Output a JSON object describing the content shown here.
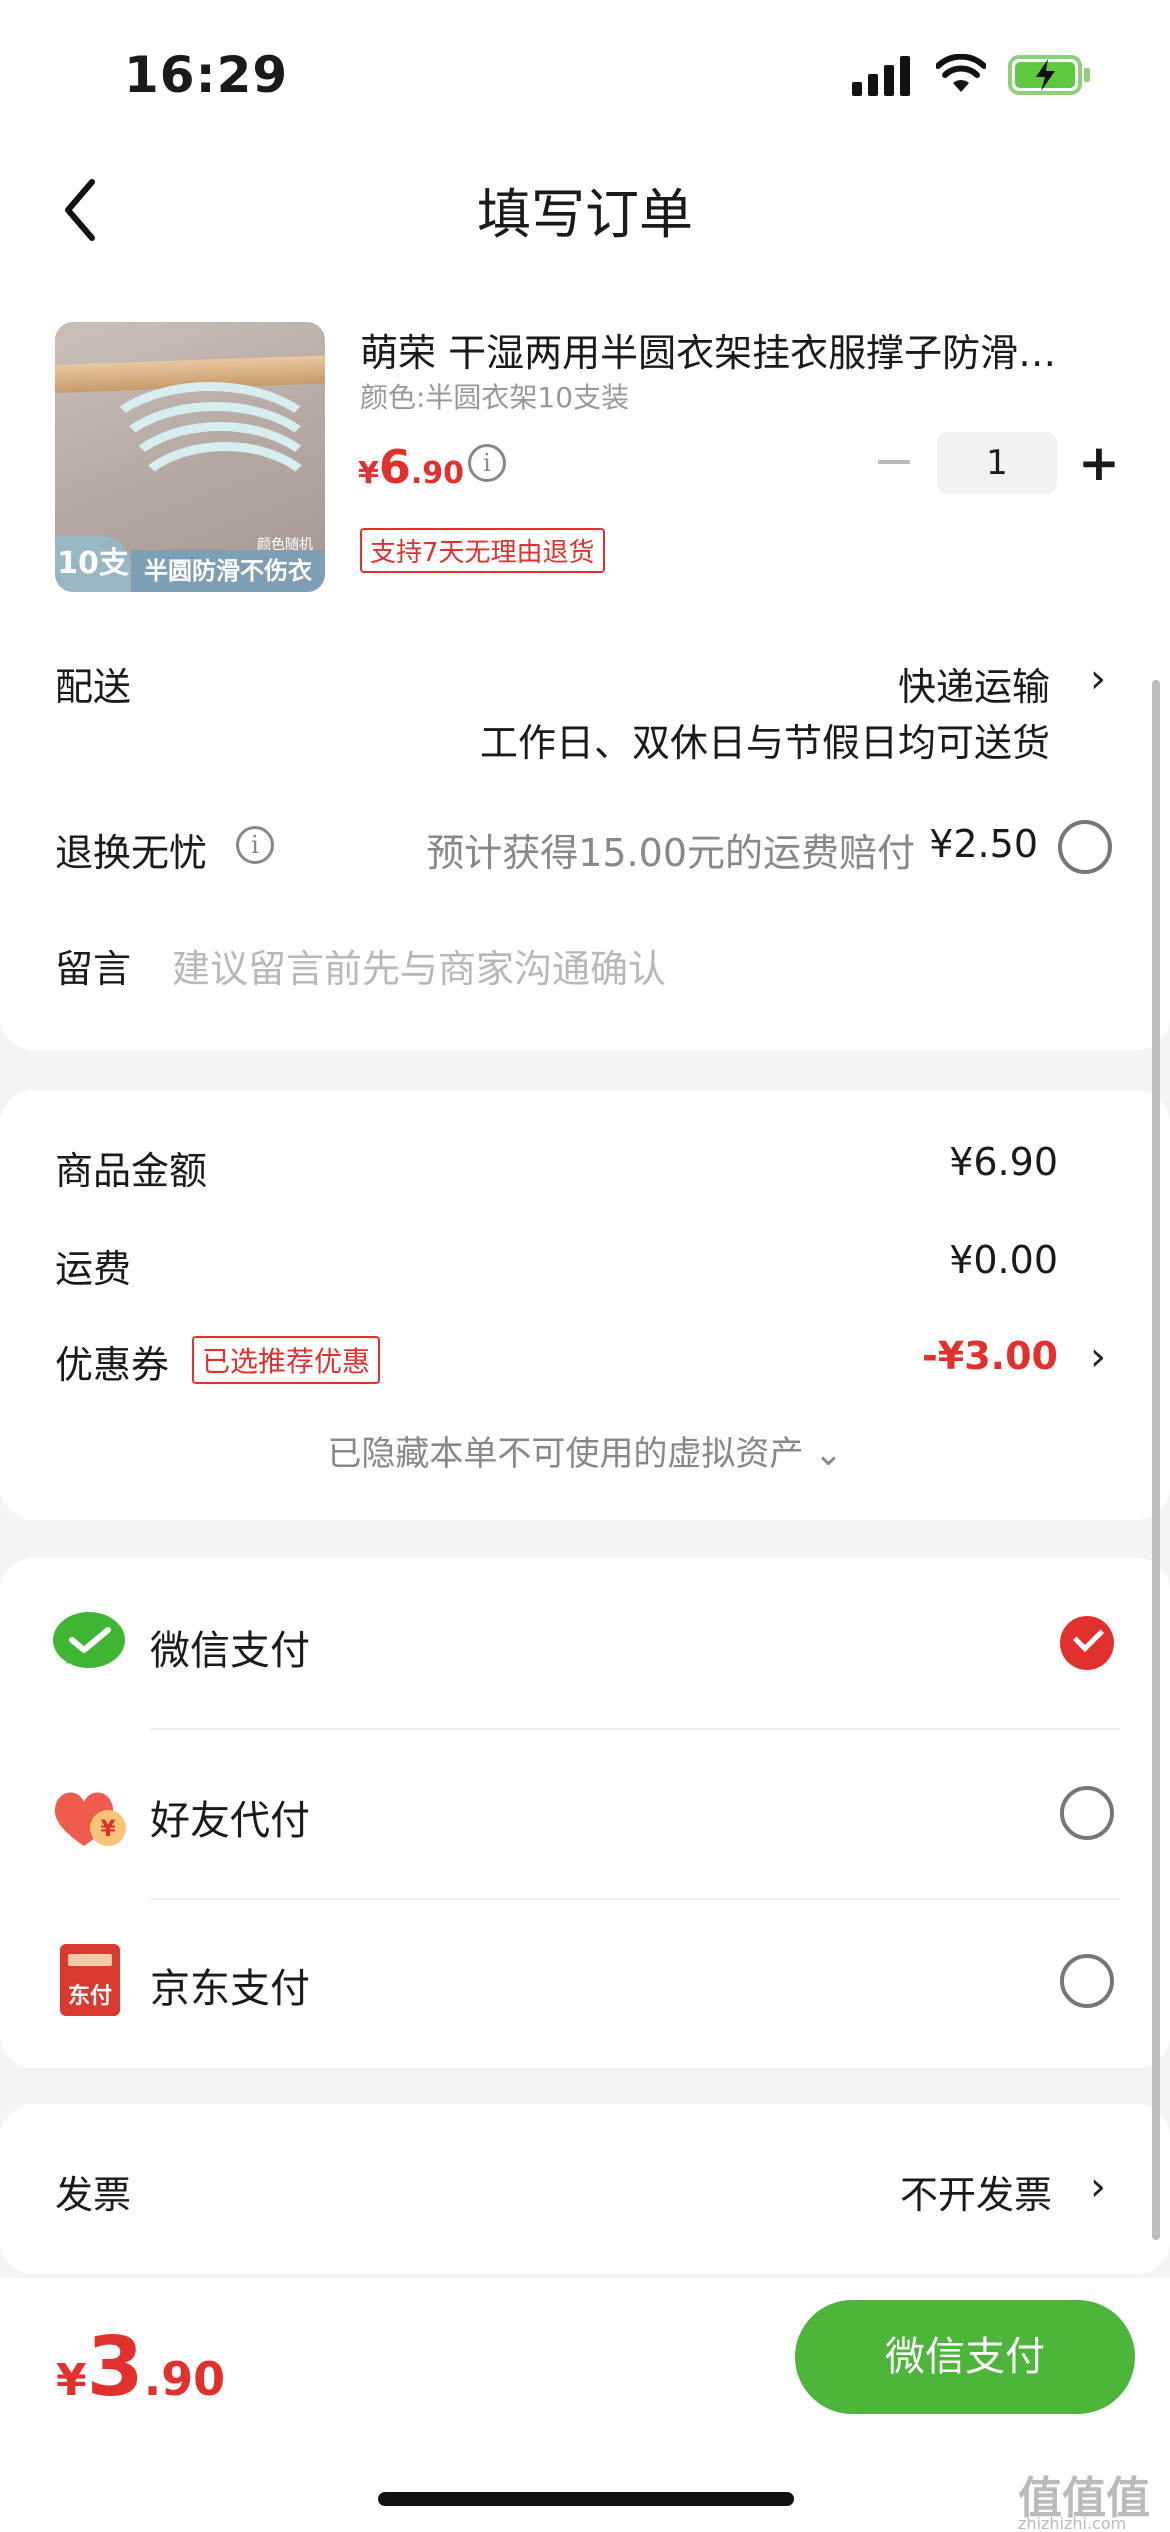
{
  "status_bar": {
    "time": "16:29"
  },
  "nav": {
    "title": "填写订单"
  },
  "product": {
    "title": "萌荣 干湿两用半圆衣架挂衣服撑子防滑…",
    "spec": "颜色:半圆衣架10支装",
    "price_currency": "¥",
    "price_int": "6",
    "price_dec": ".90",
    "quantity": "1",
    "return_badge": "支持7天无理由退货",
    "image_tag": "10支",
    "image_banner": "半圆防滑不伤衣",
    "image_small": "颜色随机"
  },
  "delivery": {
    "label": "配送",
    "method": "快递运输",
    "note": "工作日、双休日与节假日均可送货"
  },
  "return_service": {
    "label": "退换无忧",
    "desc": "预计获得15.00元的运费赔付",
    "price": "¥2.50"
  },
  "message": {
    "label": "留言",
    "placeholder": "建议留言前先与商家沟通确认"
  },
  "amounts": {
    "goods_label": "商品金额",
    "goods_value": "¥6.90",
    "shipping_label": "运费",
    "shipping_value": "¥0.00",
    "coupon_label": "优惠券",
    "coupon_badge": "已选推荐优惠",
    "coupon_value": "-¥3.00",
    "hidden_note": "已隐藏本单不可使用的虚拟资产 ⌄"
  },
  "payment": {
    "options": [
      {
        "label": "微信支付",
        "selected": true,
        "icon": "wechat-pay-icon"
      },
      {
        "label": "好友代付",
        "selected": false,
        "icon": "friend-pay-icon"
      },
      {
        "label": "京东支付",
        "selected": false,
        "icon": "jd-pay-icon"
      }
    ],
    "jd_icon_text": "东付",
    "friend_icon_text": "¥"
  },
  "invoice": {
    "label": "发票",
    "value": "不开发票"
  },
  "bottom": {
    "total_currency": "¥",
    "total_int": "3",
    "total_dec": ".90",
    "pay_button": "微信支付"
  },
  "watermark": {
    "main": "值值值",
    "sub": "zhizhizhi.com"
  },
  "colors": {
    "accent_red": "#e2312c",
    "pay_green": "#4cb53a"
  }
}
